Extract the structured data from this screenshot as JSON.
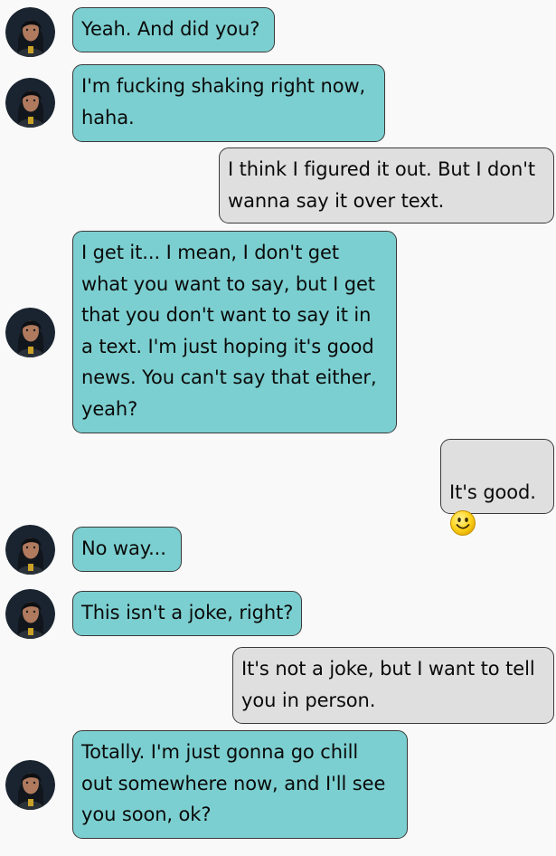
{
  "messages": [
    {
      "from": "contact",
      "text": "Yeah. And did you?"
    },
    {
      "from": "contact",
      "text": "I'm fucking shaking right now,\nhaha."
    },
    {
      "from": "me",
      "text": "I think I figured it out. But I don't\nwanna say it over text."
    },
    {
      "from": "contact",
      "text": "I get it... I mean, I don't get\nwhat you want to say, but I get\nthat you don't want to say it in\na text. I'm just hoping it's good\nnews. You can't say that either,\nyeah?"
    },
    {
      "from": "me",
      "text": "It's good.",
      "emoji": "smiley-emoji"
    },
    {
      "from": "contact",
      "text": "No way..."
    },
    {
      "from": "contact",
      "text": "This isn't a joke, right?"
    },
    {
      "from": "me",
      "text": "It's not a joke, but I want to tell\nyou in person."
    },
    {
      "from": "contact",
      "text": "Totally. I'm just gonna go chill\nout somewhere now, and I'll see\nyou soon, ok?"
    }
  ],
  "colors": {
    "incoming_bubble": "#7ccfd0",
    "outgoing_bubble": "#dfdfdf",
    "bubble_border": "#3a3a3a",
    "background": "#f9f9f9"
  },
  "icons": {
    "avatar": "contact-avatar",
    "emoji": "smiley-emoji"
  }
}
